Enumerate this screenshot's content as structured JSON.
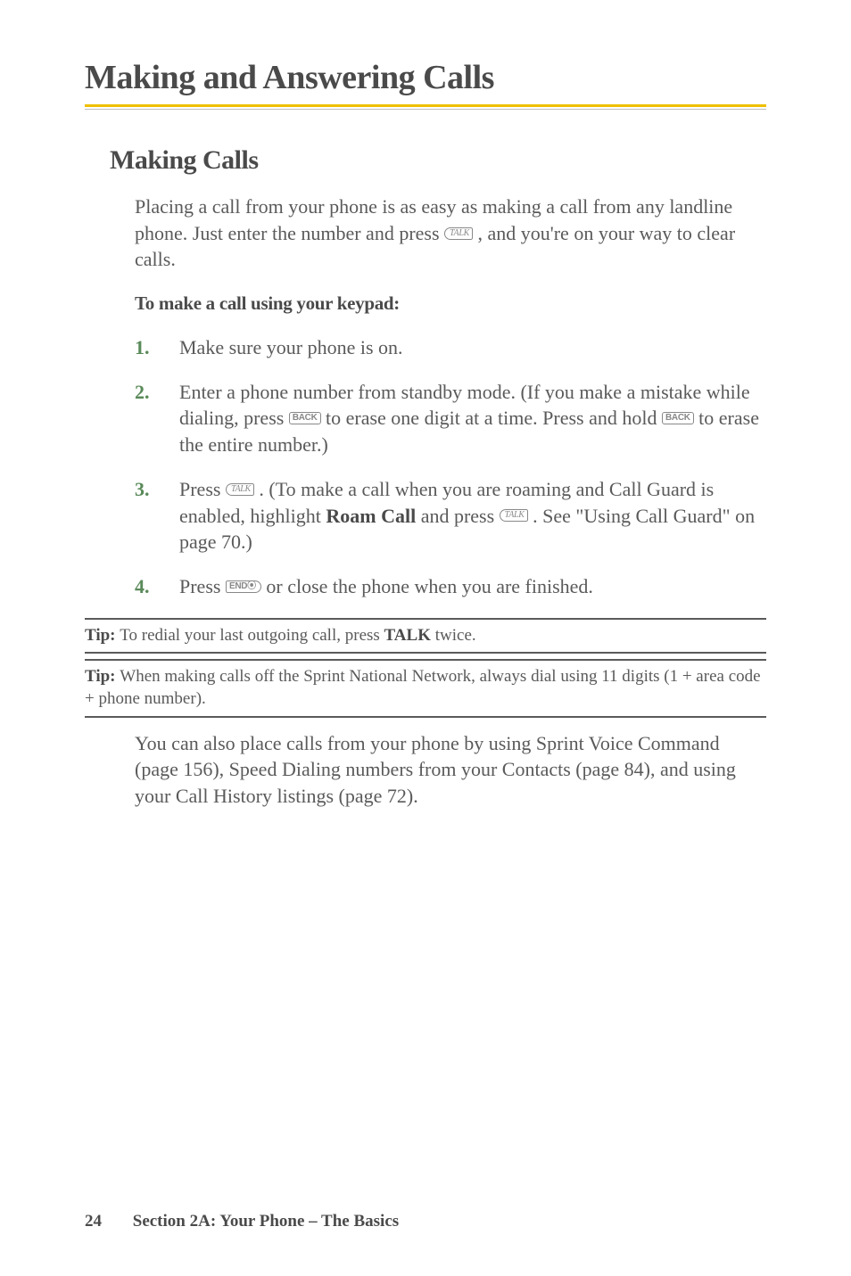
{
  "mainHeading": "Making and Answering Calls",
  "subHeading": "Making Calls",
  "introText_part1": "Placing a call from your phone is as easy as making a call from any landline phone. Just enter the number and press ",
  "introText_part2": " , and you're on your way to clear calls.",
  "subBold": "To make a call using your keypad:",
  "items": [
    {
      "num": "1.",
      "content": "Make sure your phone is on."
    },
    {
      "num": "2.",
      "part1": "Enter a phone number from standby mode. (If you make a mistake while dialing, press ",
      "part2": " to erase one digit at a time. Press and hold ",
      "part3": " to erase the entire number.)"
    },
    {
      "num": "3.",
      "part1": "Press ",
      "part2": " . (To make a call when you are roaming and Call Guard is enabled, highlight ",
      "roamCall": "Roam Call",
      "part3": " and press ",
      "part4": " . See \"Using Call Guard\" on page 70.)"
    },
    {
      "num": "4.",
      "part1": "Press ",
      "part2": " or close the phone when you are finished."
    }
  ],
  "tip1_label": "Tip: ",
  "tip1_part1": "To redial your last outgoing call, press ",
  "tip1_talk": "TALK",
  "tip1_part2": " twice.",
  "tip2_label": "Tip: ",
  "tip2_text": "When making calls off the Sprint National Network, always dial using 11 digits (1 + area code + phone number).",
  "afterTipText": "You can also place calls from your phone by using Sprint Voice Command (page 156), Speed Dialing numbers from your Contacts (page 84), and using your Call History listings (page 72).",
  "footerPage": "24",
  "footerSection": "Section 2A: Your Phone – The Basics",
  "keys": {
    "talk": "TALK",
    "back": "BACK",
    "end": "END⦿"
  }
}
